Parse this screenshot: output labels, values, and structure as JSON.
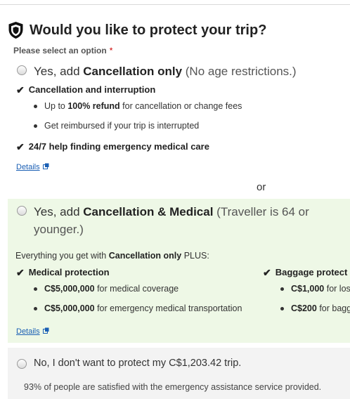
{
  "header": {
    "icon": "shield-icon",
    "title": "Would you like to protect your trip?",
    "prompt": "Please select an option",
    "required_mark": "*"
  },
  "option_cancellation": {
    "prefix": "Yes, add ",
    "name": "Cancellation only",
    "suffix": " (No age restrictions.)",
    "feature1": "Cancellation and interruption",
    "bullet1_pre": "Up to ",
    "bullet1_bold": "100% refund",
    "bullet1_post": " for cancellation or change fees",
    "bullet2": "Get reimbursed if your trip is interrupted",
    "feature2": "24/7 help finding emergency medical care",
    "details": "Details"
  },
  "separator": "or",
  "option_medical": {
    "prefix": "Yes, add ",
    "name": "Cancellation & Medical",
    "suffix": " (Traveller is 64 or younger.)",
    "plus_pre": "Everything you get with ",
    "plus_bold": "Cancellation only",
    "plus_post": " PLUS:",
    "medical_title": "Medical protection",
    "medical_b1_amount": "C$5,000,000",
    "medical_b1_text": " for medical coverage",
    "medical_b2_amount": "C$5,000,000",
    "medical_b2_text": " for emergency medical transportation",
    "baggage_title": "Baggage protect",
    "baggage_b1_amount": "C$1,000",
    "baggage_b1_text": " for los",
    "baggage_b2_amount": "C$200",
    "baggage_b2_text": " for bagg",
    "details": "Details",
    "background": "#eef8e6"
  },
  "option_none": {
    "label": "No, I don't want to protect my C$1,203.42 trip.",
    "satisfaction": "93% of people are satisfied with the emergency assistance service provided.",
    "background": "#f3f3f3"
  },
  "colors": {
    "link": "#1a5fb4",
    "required": "#cc0000"
  }
}
